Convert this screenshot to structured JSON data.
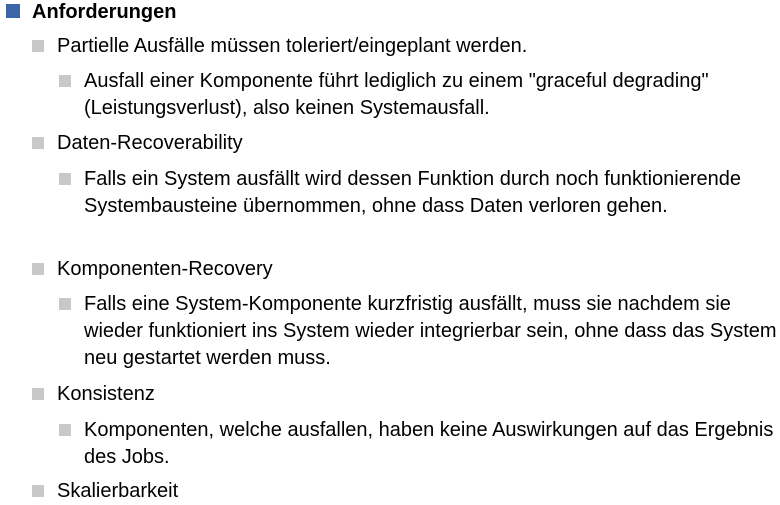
{
  "colors": {
    "primary_bullet": "#3A66A7",
    "secondary_bullet": "#C8C8C8",
    "text": "#000000"
  },
  "heading": "Anforderungen",
  "items": [
    {
      "label": "Partielle Ausfälle müssen toleriert/eingeplant werden.",
      "detail": "Ausfall einer Komponente führt lediglich zu einem \"graceful degrading\" (Leistungsverlust), also keinen Systemausfall."
    },
    {
      "label": "Daten-Recoverability",
      "detail": "Falls ein System ausfällt wird dessen Funktion durch noch funktionierende Systembausteine übernommen, ohne dass Daten verloren gehen."
    },
    {
      "label": "Komponenten-Recovery",
      "detail": "Falls eine System-Komponente kurzfristig ausfällt, muss sie nachdem sie wieder funktioniert ins System wieder integrierbar sein, ohne dass das System neu gestartet werden muss."
    },
    {
      "label": "Konsistenz",
      "detail": "Komponenten, welche ausfallen, haben keine Auswirkungen auf das Ergebnis des Jobs."
    },
    {
      "label": "Skalierbarkeit"
    }
  ]
}
